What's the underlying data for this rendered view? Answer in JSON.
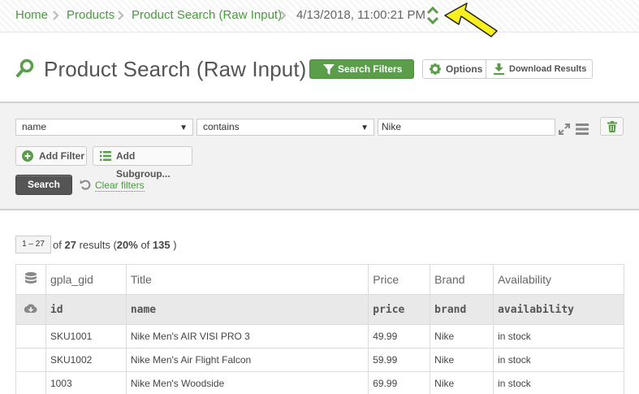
{
  "breadcrumb": {
    "items": [
      "Home",
      "Products",
      "Product Search (Raw Input)",
      "4/13/2018, 11:00:21 PM"
    ]
  },
  "header": {
    "title": "Product Search (Raw Input)",
    "search_filters_label": "Search Filters",
    "options_label": "Options",
    "download_label": "Download Results"
  },
  "filters": {
    "field_value": "name",
    "operator_value": "contains",
    "text_value": "Nike",
    "add_filter_label": "Add Filter",
    "add_subgroup_label": "Add Subgroup...",
    "search_label": "Search",
    "clear_label": "Clear filters"
  },
  "results": {
    "range": "1 – 27",
    "of_label": "of",
    "count": "27",
    "results_label": "results (",
    "percent": "20%",
    "of_total_label": "of",
    "total": "135",
    "close_paren": ")"
  },
  "table": {
    "columns": [
      {
        "label": "gpla_gid",
        "field": "id"
      },
      {
        "label": "Title",
        "field": "name"
      },
      {
        "label": "Price",
        "field": "price"
      },
      {
        "label": "Brand",
        "field": "brand"
      },
      {
        "label": "Availability",
        "field": "availability"
      }
    ],
    "rows": [
      [
        "SKU1001",
        "Nike Men's AIR VISI PRO 3",
        "49.99",
        "Nike",
        "in stock"
      ],
      [
        "SKU1002",
        "Nike Men's Air Flight Falcon",
        "59.99",
        "Nike",
        "in stock"
      ],
      [
        "1003",
        "Nike Men's Woodside",
        "69.99",
        "Nike",
        "in stock"
      ]
    ]
  },
  "colors": {
    "accent_green": "#5a9e4a",
    "link_green": "#4a9a3f",
    "arrow_yellow": "#f7f01e"
  }
}
